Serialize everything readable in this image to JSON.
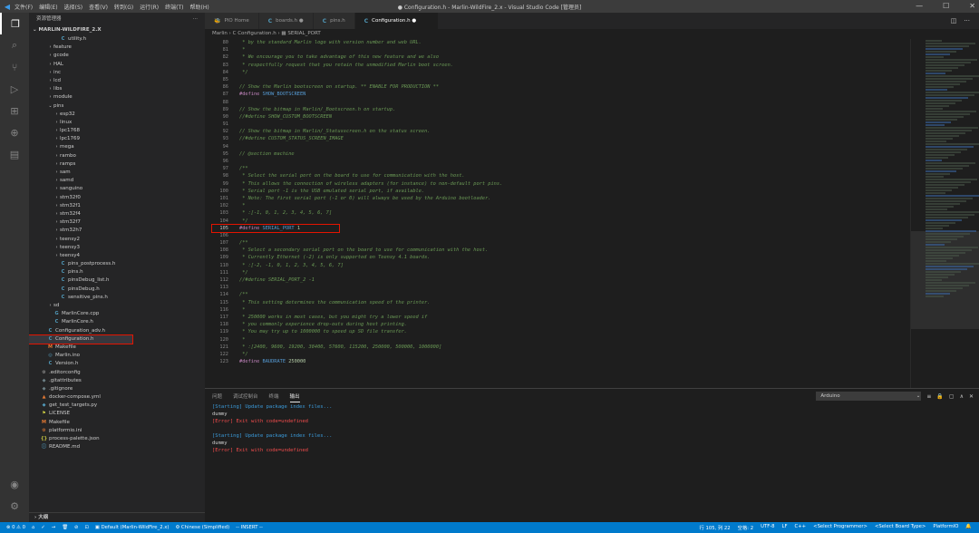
{
  "titlebar": {
    "menu": [
      "文件(F)",
      "编辑(E)",
      "选择(S)",
      "查看(V)",
      "转到(G)",
      "运行(R)",
      "终端(T)",
      "帮助(H)"
    ],
    "title": "● Configuration.h - Marlin-WildFire_2.x - Visual Studio Code [管理员]",
    "controls": [
      "—",
      "☐",
      "✕"
    ]
  },
  "sidebar": {
    "header": "资源管理器",
    "header_more": "···",
    "root": "MARLIN-WILDFIRE_2.X",
    "footer": "大纲",
    "tree": [
      {
        "indent": 3,
        "glyph": "",
        "icon": "C",
        "icolor": "#519aba",
        "label": "utility.h"
      },
      {
        "indent": 2,
        "glyph": "›",
        "icon": "",
        "icolor": "",
        "label": "feature"
      },
      {
        "indent": 2,
        "glyph": "›",
        "icon": "",
        "icolor": "",
        "label": "gcode"
      },
      {
        "indent": 2,
        "glyph": "›",
        "icon": "",
        "icolor": "",
        "label": "HAL"
      },
      {
        "indent": 2,
        "glyph": "›",
        "icon": "",
        "icolor": "",
        "label": "inc"
      },
      {
        "indent": 2,
        "glyph": "›",
        "icon": "",
        "icolor": "",
        "label": "lcd"
      },
      {
        "indent": 2,
        "glyph": "›",
        "icon": "",
        "icolor": "",
        "label": "libs"
      },
      {
        "indent": 2,
        "glyph": "›",
        "icon": "",
        "icolor": "",
        "label": "module"
      },
      {
        "indent": 2,
        "glyph": "⌄",
        "icon": "",
        "icolor": "",
        "label": "pins"
      },
      {
        "indent": 3,
        "glyph": "›",
        "icon": "",
        "icolor": "",
        "label": "esp32"
      },
      {
        "indent": 3,
        "glyph": "›",
        "icon": "",
        "icolor": "",
        "label": "linux"
      },
      {
        "indent": 3,
        "glyph": "›",
        "icon": "",
        "icolor": "",
        "label": "lpc1768"
      },
      {
        "indent": 3,
        "glyph": "›",
        "icon": "",
        "icolor": "",
        "label": "lpc1769"
      },
      {
        "indent": 3,
        "glyph": "›",
        "icon": "",
        "icolor": "",
        "label": "mega"
      },
      {
        "indent": 3,
        "glyph": "›",
        "icon": "",
        "icolor": "",
        "label": "rambo"
      },
      {
        "indent": 3,
        "glyph": "›",
        "icon": "",
        "icolor": "",
        "label": "ramps"
      },
      {
        "indent": 3,
        "glyph": "›",
        "icon": "",
        "icolor": "",
        "label": "sam"
      },
      {
        "indent": 3,
        "glyph": "›",
        "icon": "",
        "icolor": "",
        "label": "samd"
      },
      {
        "indent": 3,
        "glyph": "›",
        "icon": "",
        "icolor": "",
        "label": "sanguino"
      },
      {
        "indent": 3,
        "glyph": "›",
        "icon": "",
        "icolor": "",
        "label": "stm32f0"
      },
      {
        "indent": 3,
        "glyph": "›",
        "icon": "",
        "icolor": "",
        "label": "stm32f1"
      },
      {
        "indent": 3,
        "glyph": "›",
        "icon": "",
        "icolor": "",
        "label": "stm32f4"
      },
      {
        "indent": 3,
        "glyph": "›",
        "icon": "",
        "icolor": "",
        "label": "stm32f7"
      },
      {
        "indent": 3,
        "glyph": "›",
        "icon": "",
        "icolor": "",
        "label": "stm32h7"
      },
      {
        "indent": 3,
        "glyph": "›",
        "icon": "",
        "icolor": "",
        "label": "teensy2"
      },
      {
        "indent": 3,
        "glyph": "›",
        "icon": "",
        "icolor": "",
        "label": "teensy3"
      },
      {
        "indent": 3,
        "glyph": "›",
        "icon": "",
        "icolor": "",
        "label": "teensy4"
      },
      {
        "indent": 3,
        "glyph": "",
        "icon": "C",
        "icolor": "#519aba",
        "label": "pins_postprocess.h"
      },
      {
        "indent": 3,
        "glyph": "",
        "icon": "C",
        "icolor": "#519aba",
        "label": "pins.h"
      },
      {
        "indent": 3,
        "glyph": "",
        "icon": "C",
        "icolor": "#519aba",
        "label": "pinsDebug_list.h"
      },
      {
        "indent": 3,
        "glyph": "",
        "icon": "C",
        "icolor": "#519aba",
        "label": "pinsDebug.h"
      },
      {
        "indent": 3,
        "glyph": "",
        "icon": "C",
        "icolor": "#519aba",
        "label": "sensitive_pins.h"
      },
      {
        "indent": 2,
        "glyph": "›",
        "icon": "",
        "icolor": "",
        "label": "sd"
      },
      {
        "indent": 2,
        "glyph": "",
        "icon": "G",
        "icolor": "#519aba",
        "label": "MarlinCore.cpp"
      },
      {
        "indent": 2,
        "glyph": "",
        "icon": "C",
        "icolor": "#519aba",
        "label": "MarlinCore.h"
      },
      {
        "indent": 1,
        "glyph": "",
        "icon": "C",
        "icolor": "#519aba",
        "label": "Configuration_adv.h"
      },
      {
        "indent": 1,
        "glyph": "",
        "icon": "C",
        "icolor": "#519aba",
        "label": "Configuration.h",
        "selected": true
      },
      {
        "indent": 1,
        "glyph": "",
        "icon": "M",
        "icolor": "#e37933",
        "label": "Makefile"
      },
      {
        "indent": 1,
        "glyph": "",
        "icon": "◎",
        "icolor": "#519aba",
        "label": "Marlin.ino"
      },
      {
        "indent": 1,
        "glyph": "",
        "icon": "C",
        "icolor": "#519aba",
        "label": "Version.h"
      },
      {
        "indent": 0,
        "glyph": "",
        "icon": "⚙",
        "icolor": "#a0a0a0",
        "label": ".editorconfig"
      },
      {
        "indent": 0,
        "glyph": "",
        "icon": "◆",
        "icolor": "#6d8086",
        "label": ".gitattributes"
      },
      {
        "indent": 0,
        "glyph": "",
        "icon": "◆",
        "icolor": "#6d8086",
        "label": ".gitignore"
      },
      {
        "indent": 0,
        "glyph": "",
        "icon": "▲",
        "icolor": "#e37933",
        "label": "docker-compose.yml"
      },
      {
        "indent": 0,
        "glyph": "",
        "icon": "◆",
        "icolor": "#519aba",
        "label": "get_test_targets.py"
      },
      {
        "indent": 0,
        "glyph": "",
        "icon": "⚑",
        "icolor": "#cbcb41",
        "label": "LICENSE"
      },
      {
        "indent": 0,
        "glyph": "",
        "icon": "M",
        "icolor": "#e37933",
        "label": "Makefile"
      },
      {
        "indent": 0,
        "glyph": "",
        "icon": "⚙",
        "icolor": "#e37933",
        "label": "platformio.ini"
      },
      {
        "indent": 0,
        "glyph": "",
        "icon": "{}",
        "icolor": "#cbcb41",
        "label": "process-palette.json"
      },
      {
        "indent": 0,
        "glyph": "",
        "icon": "ⓘ",
        "icolor": "#519aba",
        "label": "README.md"
      }
    ]
  },
  "tabs": [
    {
      "icon": "🐝",
      "icolor": "#f5a623",
      "label": "PIO Home",
      "active": false
    },
    {
      "icon": "C",
      "icolor": "#519aba",
      "label": "boards.h  ●",
      "active": false
    },
    {
      "icon": "C",
      "icolor": "#519aba",
      "label": "pins.h",
      "active": false
    },
    {
      "icon": "C",
      "icolor": "#519aba",
      "label": "Configuration.h  ●",
      "active": true
    }
  ],
  "tab_controls": [
    "◫",
    "···"
  ],
  "breadcrumb": "Marlin › C Configuration.h › ▦ SERIAL_PORT",
  "code": [
    {
      "n": "80",
      "t": " * by the standard Marlin logo with version number and web URL.",
      "k": "c"
    },
    {
      "n": "81",
      "t": " *",
      "k": "c"
    },
    {
      "n": "82",
      "t": " * We encourage you to take advantage of this new feature and we also",
      "k": "c"
    },
    {
      "n": "83",
      "t": " * respectfully request that you retain the unmodified Marlin boot screen.",
      "k": "c"
    },
    {
      "n": "84",
      "t": " */",
      "k": "c"
    },
    {
      "n": "85",
      "t": "",
      "k": "c"
    },
    {
      "n": "86",
      "t": "// Show the Marlin bootscreen on startup. ** ENABLE FOR PRODUCTION **",
      "k": "c"
    },
    {
      "n": "87",
      "t": "SHOW_BOOTSCREEN",
      "k": "d",
      "v": ""
    },
    {
      "n": "88",
      "t": "",
      "k": "c"
    },
    {
      "n": "89",
      "t": "// Show the bitmap in Marlin/_Bootscreen.h on startup.",
      "k": "c"
    },
    {
      "n": "90",
      "t": "//#define SHOW_CUSTOM_BOOTSCREEN",
      "k": "c"
    },
    {
      "n": "91",
      "t": "",
      "k": "c"
    },
    {
      "n": "92",
      "t": "// Show the bitmap in Marlin/_Statusscreen.h on the status screen.",
      "k": "c"
    },
    {
      "n": "93",
      "t": "//#define CUSTOM_STATUS_SCREEN_IMAGE",
      "k": "c"
    },
    {
      "n": "94",
      "t": "",
      "k": "c"
    },
    {
      "n": "95",
      "t": "// @section machine",
      "k": "c"
    },
    {
      "n": "96",
      "t": "",
      "k": "c"
    },
    {
      "n": "97",
      "t": "/**",
      "k": "c"
    },
    {
      "n": "98",
      "t": " * Select the serial port on the board to use for communication with the host.",
      "k": "c"
    },
    {
      "n": "99",
      "t": " * This allows the connection of wireless adapters (for instance) to non-default port pins.",
      "k": "c"
    },
    {
      "n": "100",
      "t": " * Serial port -1 is the USB emulated serial port, if available.",
      "k": "c"
    },
    {
      "n": "101",
      "t": " * Note: The first serial port (-1 or 0) will always be used by the Arduino bootloader.",
      "k": "c"
    },
    {
      "n": "102",
      "t": " *",
      "k": "c"
    },
    {
      "n": "103",
      "t": " * :[-1, 0, 1, 2, 3, 4, 5, 6, 7]",
      "k": "c"
    },
    {
      "n": "104",
      "t": " */",
      "k": "c"
    },
    {
      "n": "105",
      "t": "SERIAL_PORT",
      "k": "d",
      "v": " 1",
      "cur": true
    },
    {
      "n": "106",
      "t": "",
      "k": "c"
    },
    {
      "n": "107",
      "t": "/**",
      "k": "c"
    },
    {
      "n": "108",
      "t": " * Select a secondary serial port on the board to use for communication with the host.",
      "k": "c"
    },
    {
      "n": "109",
      "t": " * Currently Ethernet (-2) is only supported on Teensy 4.1 boards.",
      "k": "c"
    },
    {
      "n": "110",
      "t": " * :[-2, -1, 0, 1, 2, 3, 4, 5, 6, 7]",
      "k": "c"
    },
    {
      "n": "111",
      "t": " */",
      "k": "c"
    },
    {
      "n": "112",
      "t": "//#define SERIAL_PORT_2 -1",
      "k": "c"
    },
    {
      "n": "113",
      "t": "",
      "k": "c"
    },
    {
      "n": "114",
      "t": "/**",
      "k": "c"
    },
    {
      "n": "115",
      "t": " * This setting determines the communication speed of the printer.",
      "k": "c"
    },
    {
      "n": "116",
      "t": " *",
      "k": "c"
    },
    {
      "n": "117",
      "t": " * 250000 works in most cases, but you might try a lower speed if",
      "k": "c"
    },
    {
      "n": "118",
      "t": " * you commonly experience drop-outs during host printing.",
      "k": "c"
    },
    {
      "n": "119",
      "t": " * You may try up to 1000000 to speed up SD file transfer.",
      "k": "c"
    },
    {
      "n": "120",
      "t": " *",
      "k": "c"
    },
    {
      "n": "121",
      "t": " * :[2400, 9600, 19200, 38400, 57600, 115200, 250000, 500000, 1000000]",
      "k": "c"
    },
    {
      "n": "122",
      "t": " */",
      "k": "c"
    },
    {
      "n": "123",
      "t": "BAUDRATE",
      "k": "d",
      "v": " 250000"
    }
  ],
  "define_keyword": "#define",
  "panel": {
    "tabs": [
      "问题",
      "调试控制台",
      "终端",
      "输出"
    ],
    "active_tab": 3,
    "channel": "Arduino",
    "channel_chevron": "⌄",
    "controls": [
      "≡",
      "🔒",
      "▢",
      "∧",
      "✕"
    ],
    "output": [
      {
        "cls": "start",
        "text": "[Starting] Update package index files..."
      },
      {
        "cls": "dummy",
        "text": "dummy"
      },
      {
        "cls": "err",
        "text": "[Error] Exit with code=undefined"
      },
      {
        "cls": "dummy",
        "text": ""
      },
      {
        "cls": "start",
        "text": "[Starting] Update package index files..."
      },
      {
        "cls": "dummy",
        "text": "dummy"
      },
      {
        "cls": "err",
        "text": "[Error] Exit with code=undefined"
      }
    ]
  },
  "statusbar": {
    "left": [
      "⊗ 0 ⚠ 0",
      "⌂",
      "✓",
      "→",
      "🗑",
      "⊘",
      "⊡",
      "▣ Default (Marlin-WildFire_2.x)",
      "⚙ Chinese (Simplified)",
      "-- INSERT --"
    ],
    "right": [
      "行 105, 列 22",
      "空格: 2",
      "UTF-8",
      "LF",
      "C++",
      "<Select Programmer>",
      "<Select Board Type>",
      "PlatformIO",
      "🔔"
    ]
  },
  "activity": {
    "top": [
      "❐",
      "⌕",
      "⑂",
      "▷",
      "⊞",
      "⊕",
      "▤"
    ],
    "bottom": [
      "◉",
      "⚙"
    ]
  },
  "colors": {
    "accent": "#007acc",
    "highlight_box": "#e51400"
  }
}
